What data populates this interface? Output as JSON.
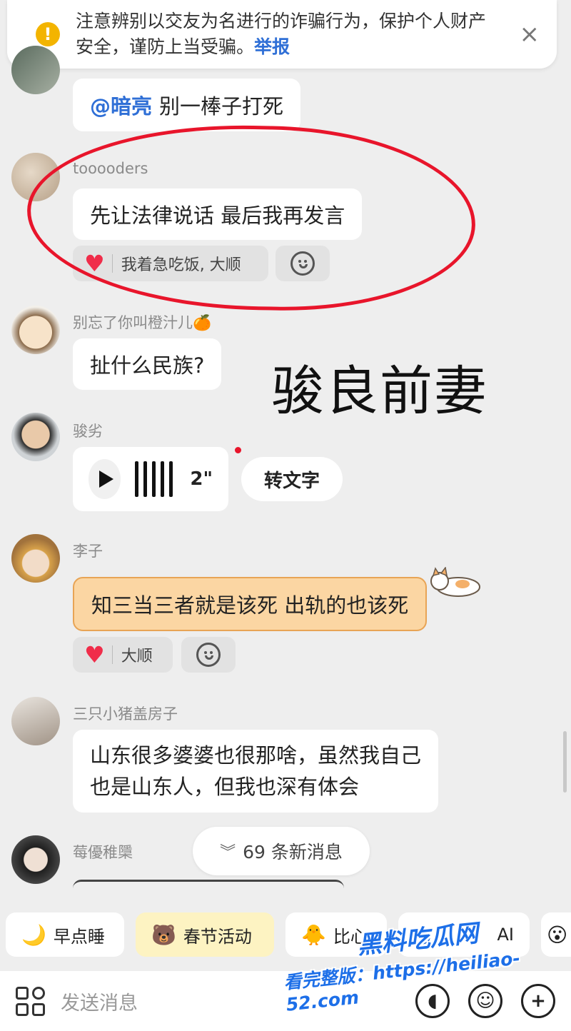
{
  "banner": {
    "text": "注意辨别以交友为名进行的诈骗行为，保护个人财产安全，谨防上当受骗。",
    "link": "举报",
    "close": "×"
  },
  "messages": [
    {
      "mention": "@暗亮",
      "text": "别一棒子打死"
    },
    {
      "user": "tooooders",
      "text": "先让法律说话 最后我再发言",
      "reaction": "我着急吃饭, 大顺"
    },
    {
      "user": "别忘了你叫橙汁儿🍊",
      "text": "扯什么民族?"
    },
    {
      "user": "骏劣",
      "voice_duration": "2\"",
      "to_text": "转文字"
    },
    {
      "user": "李子",
      "text": "知三当三者就是该死 出轨的也该死",
      "reaction": "大顺"
    },
    {
      "user": "三只小猪盖房子",
      "text_line1": "山东很多婆婆也很那啥，虽然我自己",
      "text_line2": "也是山东人，但我也深有体会"
    },
    {
      "user": "莓優稚檃"
    }
  ],
  "overlay_caption": "骏良前妻",
  "new_messages": "69 条新消息",
  "chips": [
    {
      "label": "早点睡",
      "icon": "🌙"
    },
    {
      "label": "春节活动",
      "icon": "🐻"
    },
    {
      "label": "比心",
      "icon": "🐥"
    },
    {
      "label": "AI",
      "icon": "◎"
    }
  ],
  "input": {
    "placeholder": "发送消息"
  },
  "watermark": {
    "line1": "黑料吃瓜网",
    "line2": "看完整版：https://heiliao-52.com"
  },
  "colors": {
    "link": "#2f6fd6",
    "annotation": "#e8152b",
    "highlight_bubble": "#fbd6a3"
  }
}
